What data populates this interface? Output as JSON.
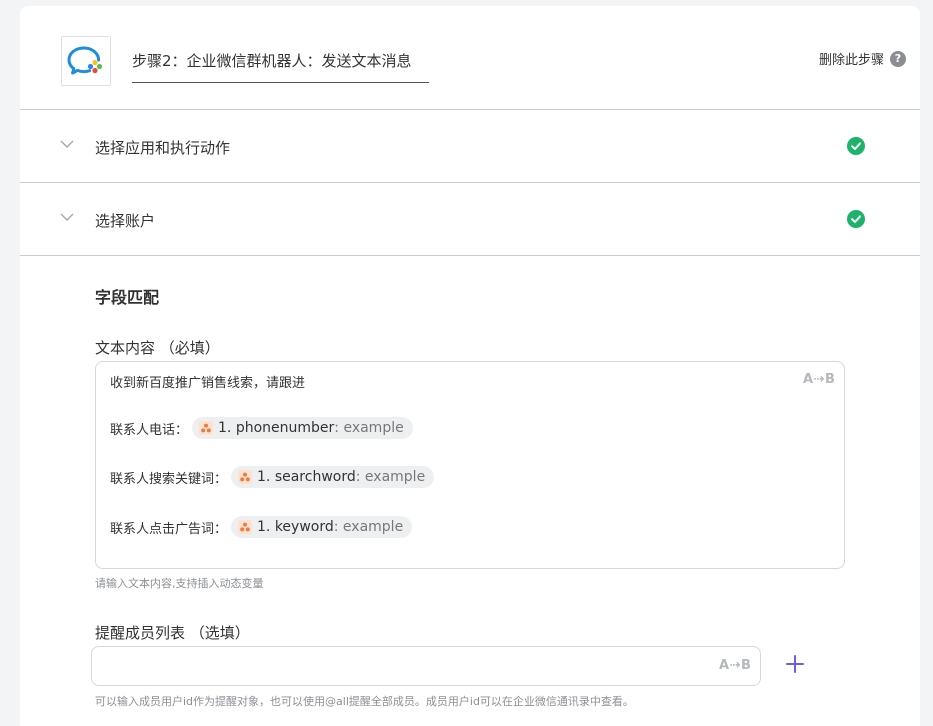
{
  "header": {
    "step_title": "步骤2：企业微信群机器人：发送文本消息",
    "delete_label": "删除此步骤",
    "help_glyph": "?"
  },
  "sections": [
    {
      "label": "选择应用和执行动作",
      "status": "complete"
    },
    {
      "label": "选择账户",
      "status": "complete"
    }
  ],
  "field_mapping": {
    "title": "字段匹配",
    "text_content": {
      "label": "文本内容 （必填）",
      "format_toggle": "A⇢B",
      "first_line": "收到新百度推广销售线索，请跟进",
      "lines": [
        {
          "prefix": "联系人电话：",
          "var_name": "1. phonenumber",
          "var_value": ": example"
        },
        {
          "prefix": "联系人搜索关键词：",
          "var_name": "1. searchword",
          "var_value": ": example"
        },
        {
          "prefix": "联系人点击广告词：",
          "var_name": "1. keyword",
          "var_value": ": example"
        }
      ],
      "hint": "请输入文本内容,支持插入动态变量"
    },
    "members": {
      "label": "提醒成员列表 （选填）",
      "value": "",
      "format_toggle": "A⇢B",
      "hint": "可以输入成员用户id作为提醒对象，也可以使用@all提醒全部成员。成员用户id可以在企业微信通讯录中查看。"
    }
  },
  "colors": {
    "success": "#1db36b",
    "accent": "#6c5ce7",
    "chip_bg": "#eeeff1",
    "chip_icon": "#f07b3f"
  },
  "icons": {
    "app": "wecom-bot-icon",
    "expand": "chevron-down-icon",
    "complete": "check-circle-icon",
    "variable": "source-app-icon",
    "add": "plus-icon"
  }
}
